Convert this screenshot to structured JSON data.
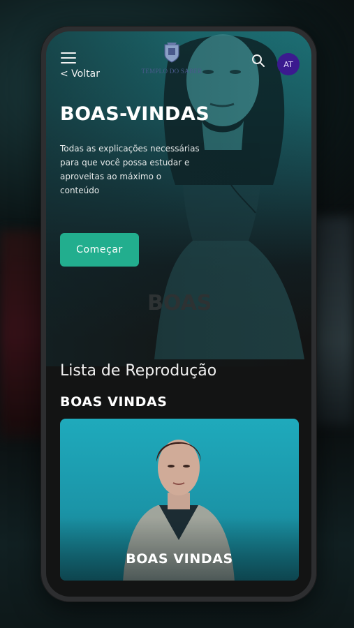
{
  "header": {
    "back_label": "< Voltar",
    "logo_text": "TEMPLO DO SABER",
    "avatar_initials": "AT"
  },
  "hero": {
    "title": "BOAS-VINDAS",
    "description": "Todas as explicações necessárias para que você possa estudar e aproveitas ao máximo o conteúdo",
    "cta_label": "Começar",
    "watermark": "BOAS"
  },
  "playlist": {
    "heading": "Lista de Reprodução",
    "section_title": "BOAS VINDAS",
    "items": [
      {
        "label": "BOAS VINDAS"
      }
    ]
  },
  "colors": {
    "accent": "#22ae8e",
    "avatar": "#3b1a8f",
    "screen_bg": "#131414",
    "hero_teal": "#1c6e73",
    "card_teal": "#1faabc"
  }
}
